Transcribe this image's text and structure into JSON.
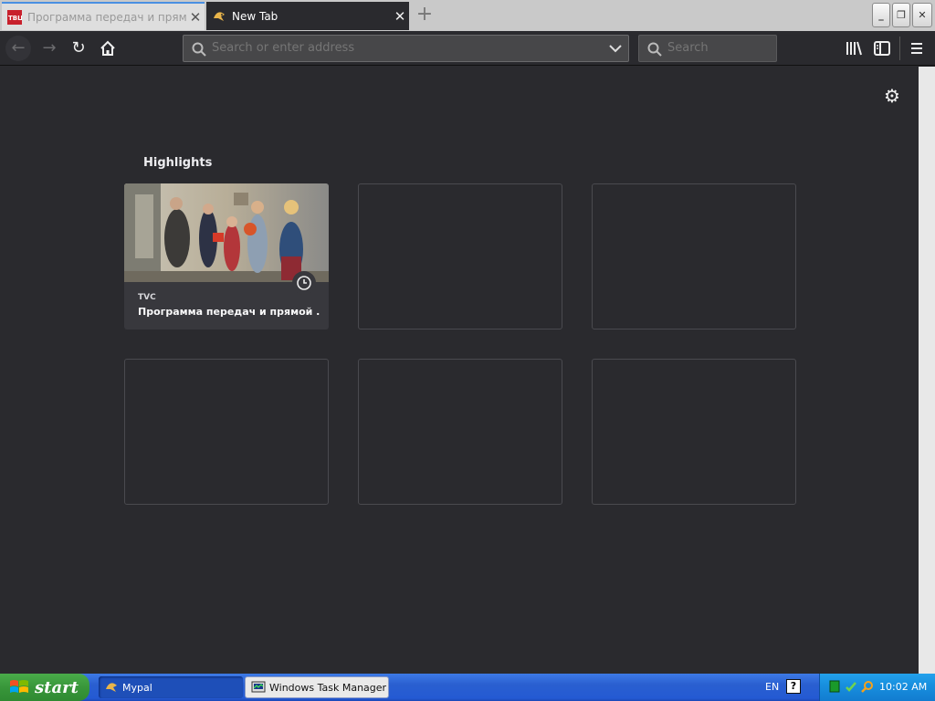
{
  "browser": {
    "tabs": [
      {
        "title": "Программа передач и прямой эф",
        "active": false,
        "favicon": "tvc-logo-icon"
      },
      {
        "title": "New Tab",
        "active": true,
        "favicon": "mypal-logo-icon"
      }
    ],
    "new_tab_icon": "plus-icon",
    "window_controls": [
      "minimize-icon",
      "restore-icon",
      "close-icon"
    ],
    "nav": {
      "back_icon": "back-arrow-icon",
      "forward_icon": "forward-arrow-icon",
      "reload_icon": "reload-icon",
      "home_icon": "home-icon"
    },
    "urlbar": {
      "placeholder": "Search or enter address",
      "value": ""
    },
    "searchbar": {
      "placeholder": "Search",
      "value": ""
    },
    "toolbar_icons": [
      "library-icon",
      "sidebar-icon",
      "hamburger-menu-icon"
    ]
  },
  "newtab": {
    "settings_icon": "gear-icon",
    "highlights_title": "Highlights",
    "highlights": [
      {
        "site": "TVC",
        "title": "Программа передач и прямой ...",
        "badge_icon": "clock-icon"
      }
    ],
    "empty_slots": 5
  },
  "taskbar": {
    "start_label": "start",
    "tasks": [
      {
        "label": "Mypal",
        "icon": "mypal-logo-icon",
        "active": true
      },
      {
        "label": "Windows Task Manager",
        "icon": "task-manager-icon",
        "active": false
      }
    ],
    "language": "EN",
    "help_label": "?",
    "clock": "10:02 AM"
  },
  "colors": {
    "content_bg": "#2a2a2e",
    "taskbar_blue": "#245ad3",
    "start_green": "#38963a",
    "tray_blue": "#1890df"
  }
}
